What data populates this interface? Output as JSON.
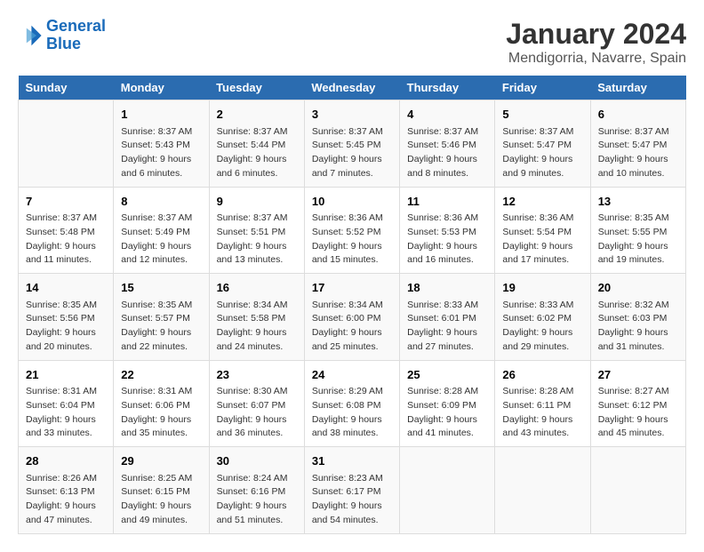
{
  "header": {
    "logo_line1": "General",
    "logo_line2": "Blue",
    "title": "January 2024",
    "subtitle": "Mendigorria, Navarre, Spain"
  },
  "weekdays": [
    "Sunday",
    "Monday",
    "Tuesday",
    "Wednesday",
    "Thursday",
    "Friday",
    "Saturday"
  ],
  "weeks": [
    [
      {
        "day": "",
        "sunrise": "",
        "sunset": "",
        "daylight": ""
      },
      {
        "day": "1",
        "sunrise": "Sunrise: 8:37 AM",
        "sunset": "Sunset: 5:43 PM",
        "daylight": "Daylight: 9 hours and 6 minutes."
      },
      {
        "day": "2",
        "sunrise": "Sunrise: 8:37 AM",
        "sunset": "Sunset: 5:44 PM",
        "daylight": "Daylight: 9 hours and 6 minutes."
      },
      {
        "day": "3",
        "sunrise": "Sunrise: 8:37 AM",
        "sunset": "Sunset: 5:45 PM",
        "daylight": "Daylight: 9 hours and 7 minutes."
      },
      {
        "day": "4",
        "sunrise": "Sunrise: 8:37 AM",
        "sunset": "Sunset: 5:46 PM",
        "daylight": "Daylight: 9 hours and 8 minutes."
      },
      {
        "day": "5",
        "sunrise": "Sunrise: 8:37 AM",
        "sunset": "Sunset: 5:47 PM",
        "daylight": "Daylight: 9 hours and 9 minutes."
      },
      {
        "day": "6",
        "sunrise": "Sunrise: 8:37 AM",
        "sunset": "Sunset: 5:47 PM",
        "daylight": "Daylight: 9 hours and 10 minutes."
      }
    ],
    [
      {
        "day": "7",
        "sunrise": "Sunrise: 8:37 AM",
        "sunset": "Sunset: 5:48 PM",
        "daylight": "Daylight: 9 hours and 11 minutes."
      },
      {
        "day": "8",
        "sunrise": "Sunrise: 8:37 AM",
        "sunset": "Sunset: 5:49 PM",
        "daylight": "Daylight: 9 hours and 12 minutes."
      },
      {
        "day": "9",
        "sunrise": "Sunrise: 8:37 AM",
        "sunset": "Sunset: 5:51 PM",
        "daylight": "Daylight: 9 hours and 13 minutes."
      },
      {
        "day": "10",
        "sunrise": "Sunrise: 8:36 AM",
        "sunset": "Sunset: 5:52 PM",
        "daylight": "Daylight: 9 hours and 15 minutes."
      },
      {
        "day": "11",
        "sunrise": "Sunrise: 8:36 AM",
        "sunset": "Sunset: 5:53 PM",
        "daylight": "Daylight: 9 hours and 16 minutes."
      },
      {
        "day": "12",
        "sunrise": "Sunrise: 8:36 AM",
        "sunset": "Sunset: 5:54 PM",
        "daylight": "Daylight: 9 hours and 17 minutes."
      },
      {
        "day": "13",
        "sunrise": "Sunrise: 8:35 AM",
        "sunset": "Sunset: 5:55 PM",
        "daylight": "Daylight: 9 hours and 19 minutes."
      }
    ],
    [
      {
        "day": "14",
        "sunrise": "Sunrise: 8:35 AM",
        "sunset": "Sunset: 5:56 PM",
        "daylight": "Daylight: 9 hours and 20 minutes."
      },
      {
        "day": "15",
        "sunrise": "Sunrise: 8:35 AM",
        "sunset": "Sunset: 5:57 PM",
        "daylight": "Daylight: 9 hours and 22 minutes."
      },
      {
        "day": "16",
        "sunrise": "Sunrise: 8:34 AM",
        "sunset": "Sunset: 5:58 PM",
        "daylight": "Daylight: 9 hours and 24 minutes."
      },
      {
        "day": "17",
        "sunrise": "Sunrise: 8:34 AM",
        "sunset": "Sunset: 6:00 PM",
        "daylight": "Daylight: 9 hours and 25 minutes."
      },
      {
        "day": "18",
        "sunrise": "Sunrise: 8:33 AM",
        "sunset": "Sunset: 6:01 PM",
        "daylight": "Daylight: 9 hours and 27 minutes."
      },
      {
        "day": "19",
        "sunrise": "Sunrise: 8:33 AM",
        "sunset": "Sunset: 6:02 PM",
        "daylight": "Daylight: 9 hours and 29 minutes."
      },
      {
        "day": "20",
        "sunrise": "Sunrise: 8:32 AM",
        "sunset": "Sunset: 6:03 PM",
        "daylight": "Daylight: 9 hours and 31 minutes."
      }
    ],
    [
      {
        "day": "21",
        "sunrise": "Sunrise: 8:31 AM",
        "sunset": "Sunset: 6:04 PM",
        "daylight": "Daylight: 9 hours and 33 minutes."
      },
      {
        "day": "22",
        "sunrise": "Sunrise: 8:31 AM",
        "sunset": "Sunset: 6:06 PM",
        "daylight": "Daylight: 9 hours and 35 minutes."
      },
      {
        "day": "23",
        "sunrise": "Sunrise: 8:30 AM",
        "sunset": "Sunset: 6:07 PM",
        "daylight": "Daylight: 9 hours and 36 minutes."
      },
      {
        "day": "24",
        "sunrise": "Sunrise: 8:29 AM",
        "sunset": "Sunset: 6:08 PM",
        "daylight": "Daylight: 9 hours and 38 minutes."
      },
      {
        "day": "25",
        "sunrise": "Sunrise: 8:28 AM",
        "sunset": "Sunset: 6:09 PM",
        "daylight": "Daylight: 9 hours and 41 minutes."
      },
      {
        "day": "26",
        "sunrise": "Sunrise: 8:28 AM",
        "sunset": "Sunset: 6:11 PM",
        "daylight": "Daylight: 9 hours and 43 minutes."
      },
      {
        "day": "27",
        "sunrise": "Sunrise: 8:27 AM",
        "sunset": "Sunset: 6:12 PM",
        "daylight": "Daylight: 9 hours and 45 minutes."
      }
    ],
    [
      {
        "day": "28",
        "sunrise": "Sunrise: 8:26 AM",
        "sunset": "Sunset: 6:13 PM",
        "daylight": "Daylight: 9 hours and 47 minutes."
      },
      {
        "day": "29",
        "sunrise": "Sunrise: 8:25 AM",
        "sunset": "Sunset: 6:15 PM",
        "daylight": "Daylight: 9 hours and 49 minutes."
      },
      {
        "day": "30",
        "sunrise": "Sunrise: 8:24 AM",
        "sunset": "Sunset: 6:16 PM",
        "daylight": "Daylight: 9 hours and 51 minutes."
      },
      {
        "day": "31",
        "sunrise": "Sunrise: 8:23 AM",
        "sunset": "Sunset: 6:17 PM",
        "daylight": "Daylight: 9 hours and 54 minutes."
      },
      {
        "day": "",
        "sunrise": "",
        "sunset": "",
        "daylight": ""
      },
      {
        "day": "",
        "sunrise": "",
        "sunset": "",
        "daylight": ""
      },
      {
        "day": "",
        "sunrise": "",
        "sunset": "",
        "daylight": ""
      }
    ]
  ]
}
